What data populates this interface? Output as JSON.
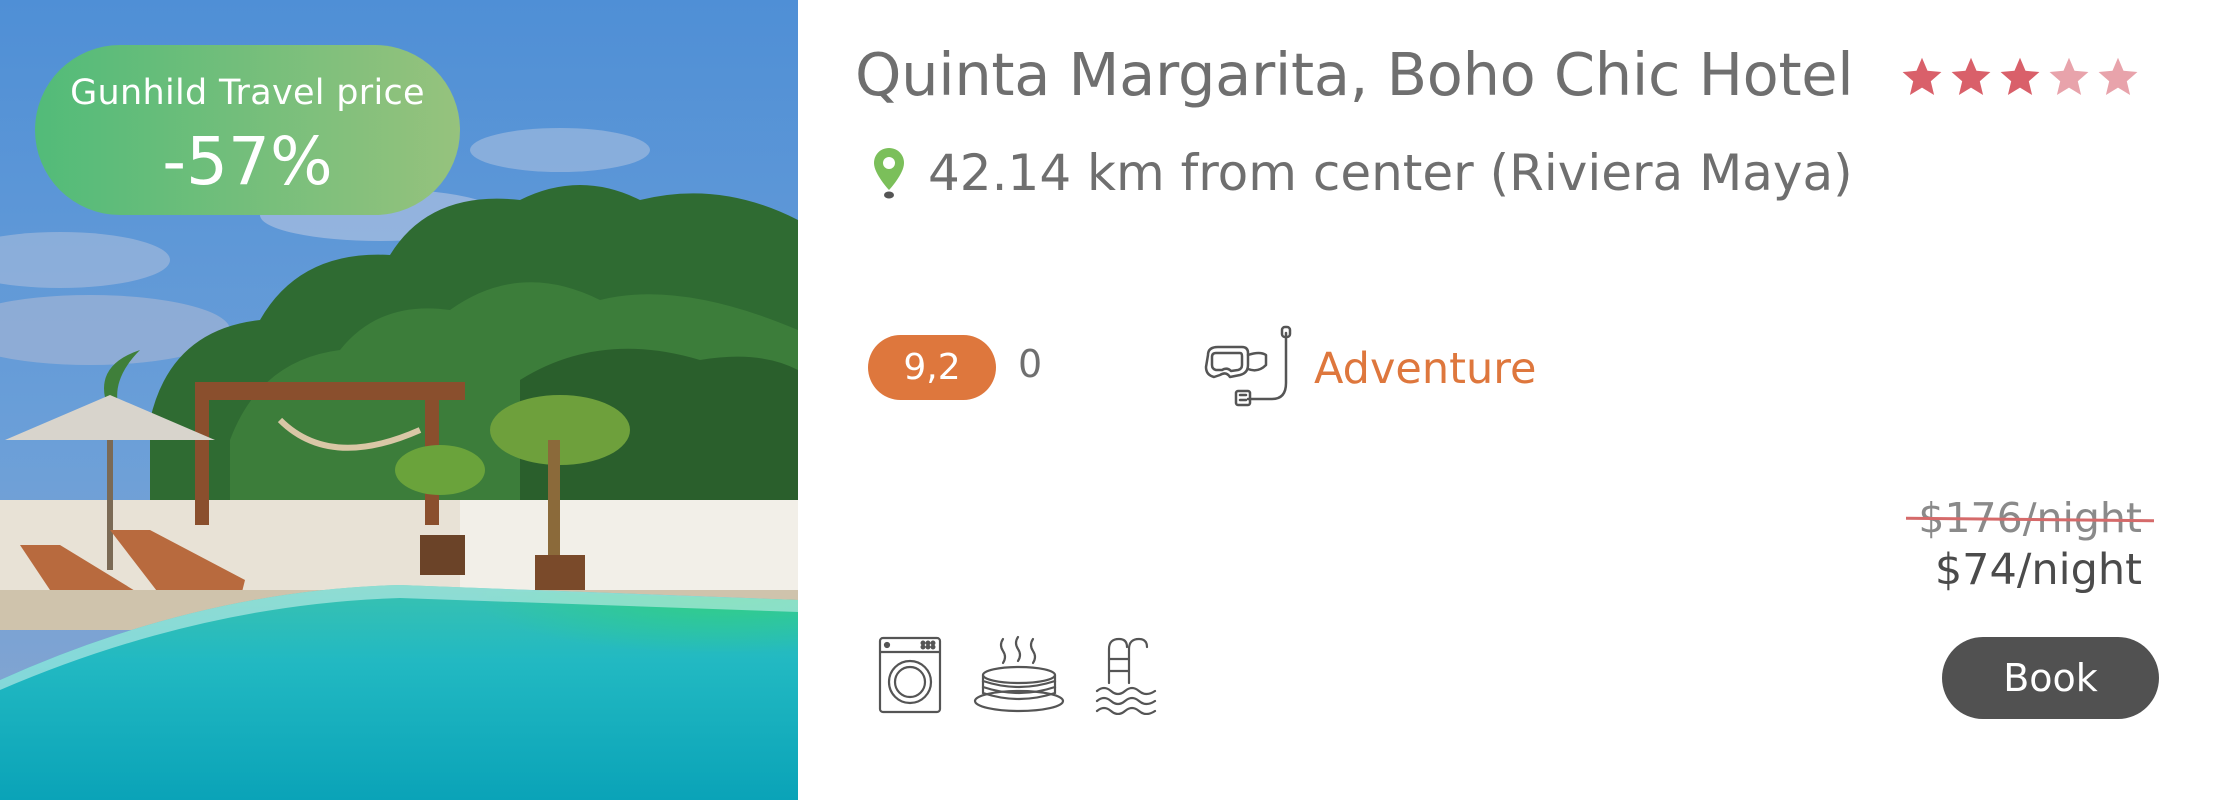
{
  "discount": {
    "label": "Gunhild Travel price",
    "value": "-57%"
  },
  "hotel": {
    "name": "Quinta Margarita, Boho Chic Hotel",
    "stars": {
      "filled": 3,
      "total": 5
    },
    "location": "42.14 km from center (Riviera Maya)"
  },
  "rating": {
    "score": "9,2",
    "reviews": "0"
  },
  "theme": {
    "label": "Adventure",
    "icon": "snorkel-mask-icon"
  },
  "amenities": [
    {
      "name": "washing-machine-icon"
    },
    {
      "name": "pancakes-breakfast-icon"
    },
    {
      "name": "swimming-pool-icon"
    }
  ],
  "pricing": {
    "original": "$176/night",
    "current": "$74/night"
  },
  "actions": {
    "book_label": "Book"
  },
  "colors": {
    "accent": "#de773d",
    "badge_start": "#52bb79",
    "badge_end": "#96c27d",
    "star_filled": "#d9606a",
    "star_faded": "#e8a3ab",
    "pin": "#7bbf5a",
    "button": "#515151",
    "text": "#6f6f6f"
  }
}
